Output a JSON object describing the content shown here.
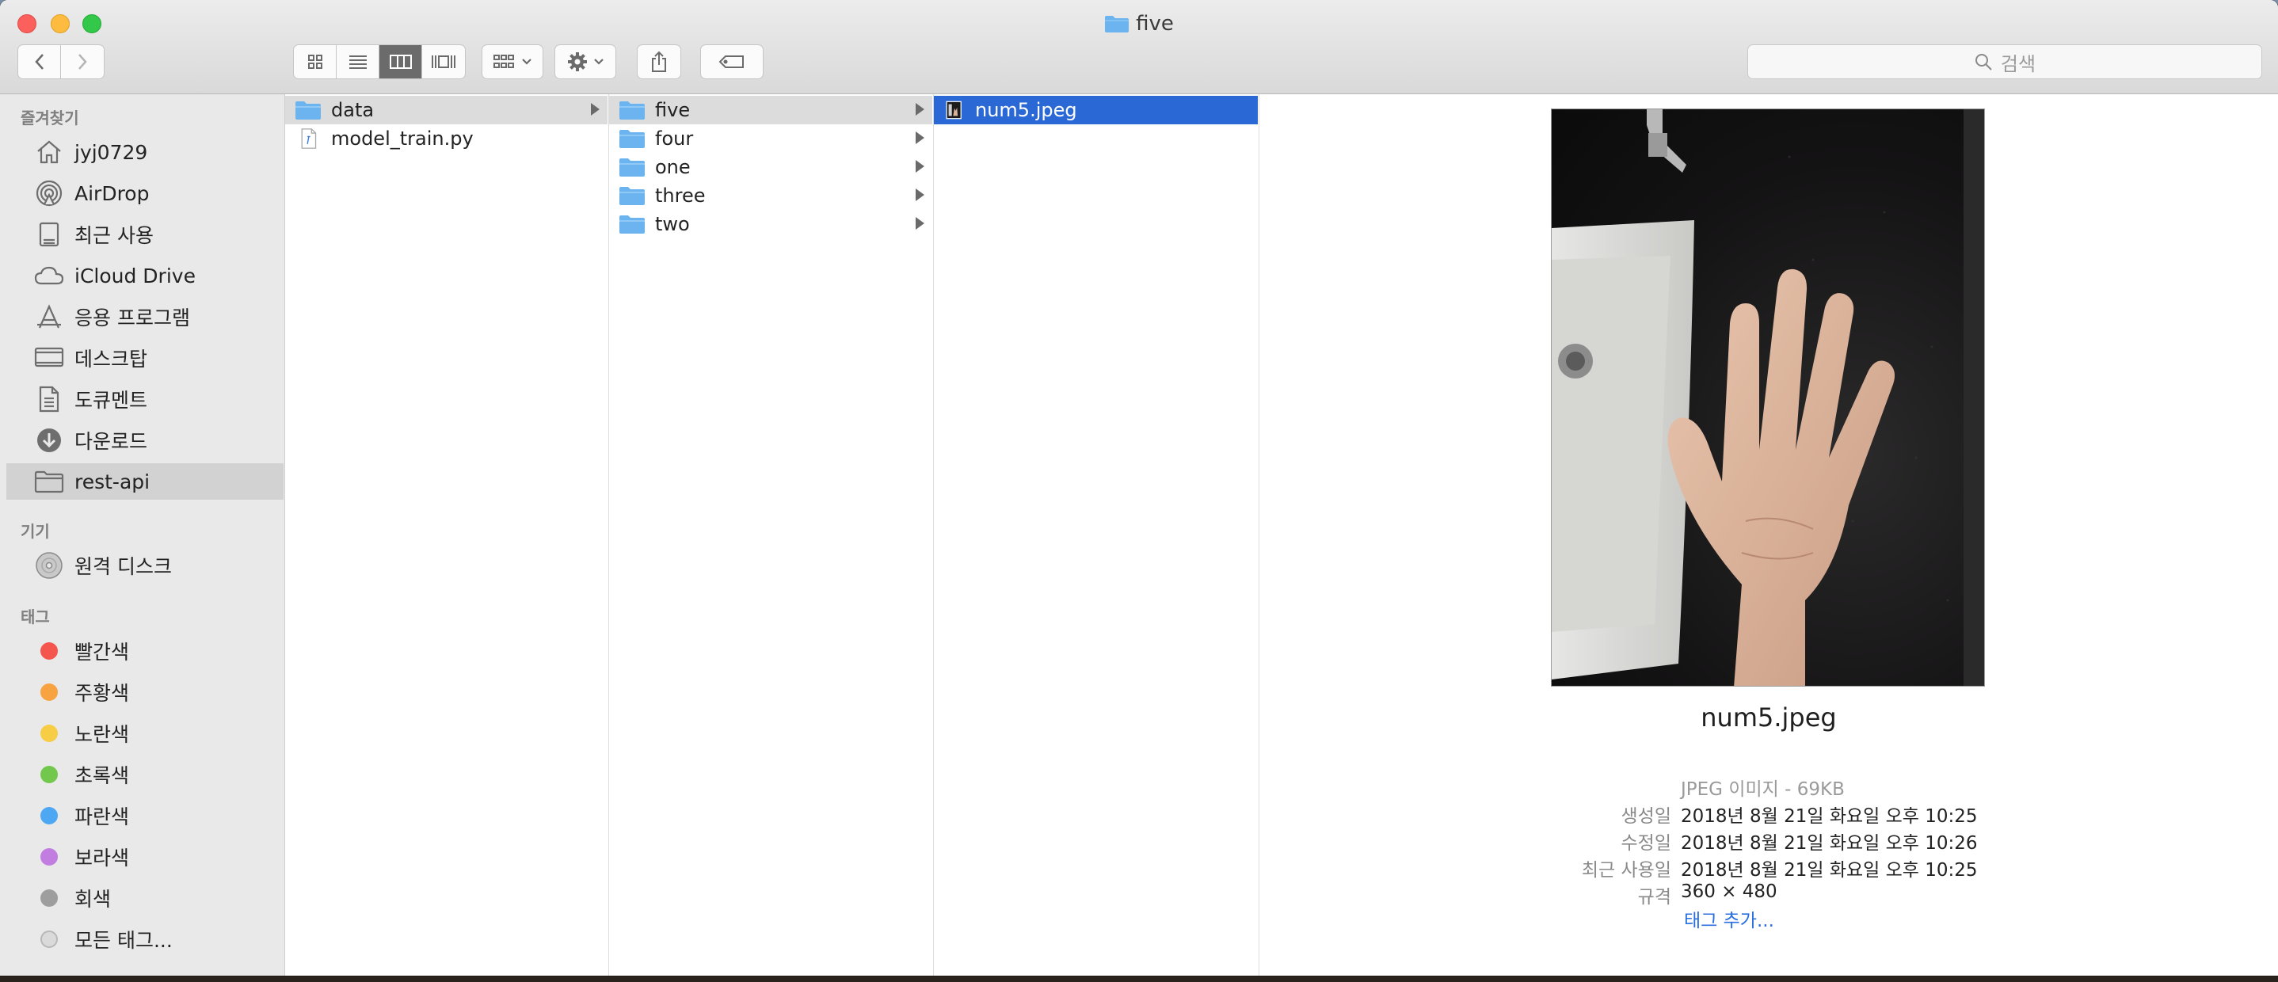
{
  "window": {
    "title": "five"
  },
  "search": {
    "placeholder": "검색"
  },
  "sidebar": {
    "favorites_heading": "즐겨찾기",
    "favorites": [
      {
        "label": "jyj0729",
        "icon": "home-icon"
      },
      {
        "label": "AirDrop",
        "icon": "airdrop-icon"
      },
      {
        "label": "최근 사용",
        "icon": "recents-icon"
      },
      {
        "label": "iCloud Drive",
        "icon": "cloud-icon"
      },
      {
        "label": "응용 프로그램",
        "icon": "applications-icon"
      },
      {
        "label": "데스크탑",
        "icon": "desktop-icon"
      },
      {
        "label": "도큐멘트",
        "icon": "documents-icon"
      },
      {
        "label": "다운로드",
        "icon": "downloads-icon"
      },
      {
        "label": "rest-api",
        "icon": "folder-icon",
        "selected": true
      }
    ],
    "devices_heading": "기기",
    "devices": [
      {
        "label": "원격 디스크",
        "icon": "disc-icon"
      }
    ],
    "tags_heading": "태그",
    "tags": [
      {
        "label": "빨간색",
        "color": "#f4564e"
      },
      {
        "label": "주황색",
        "color": "#f7a341"
      },
      {
        "label": "노란색",
        "color": "#f6cd45"
      },
      {
        "label": "초록색",
        "color": "#72c84c"
      },
      {
        "label": "파란색",
        "color": "#4ea7f3"
      },
      {
        "label": "보라색",
        "color": "#c27de0"
      },
      {
        "label": "회색",
        "color": "#9e9e9e"
      },
      {
        "label": "모든 태그...",
        "color": "#dadada"
      }
    ]
  },
  "columns": {
    "col1": [
      {
        "label": "data",
        "type": "folder",
        "selected": true
      },
      {
        "label": "model_train.py",
        "type": "file"
      }
    ],
    "col2": [
      {
        "label": "five",
        "type": "folder",
        "selected": true
      },
      {
        "label": "four",
        "type": "folder"
      },
      {
        "label": "one",
        "type": "folder"
      },
      {
        "label": "three",
        "type": "folder"
      },
      {
        "label": "two",
        "type": "folder"
      }
    ],
    "col3": [
      {
        "label": "num5.jpeg",
        "type": "image",
        "selected": true
      }
    ]
  },
  "preview": {
    "filename": "num5.jpeg",
    "kind": "JPEG 이미지 - 69KB",
    "meta": [
      {
        "label": "생성일",
        "value": "2018년 8월 21일 화요일 오후 10:25"
      },
      {
        "label": "수정일",
        "value": "2018년 8월 21일 화요일 오후 10:26"
      },
      {
        "label": "최근 사용일",
        "value": "2018년 8월 21일 화요일 오후 10:25"
      },
      {
        "label": "규격",
        "value": "360 × 480"
      }
    ],
    "add_tags": "태그 추가..."
  },
  "colors": {
    "selection_blue": "#2a68d6",
    "folder_blue": "#6bb4f0",
    "link_blue": "#2a6fdf"
  }
}
